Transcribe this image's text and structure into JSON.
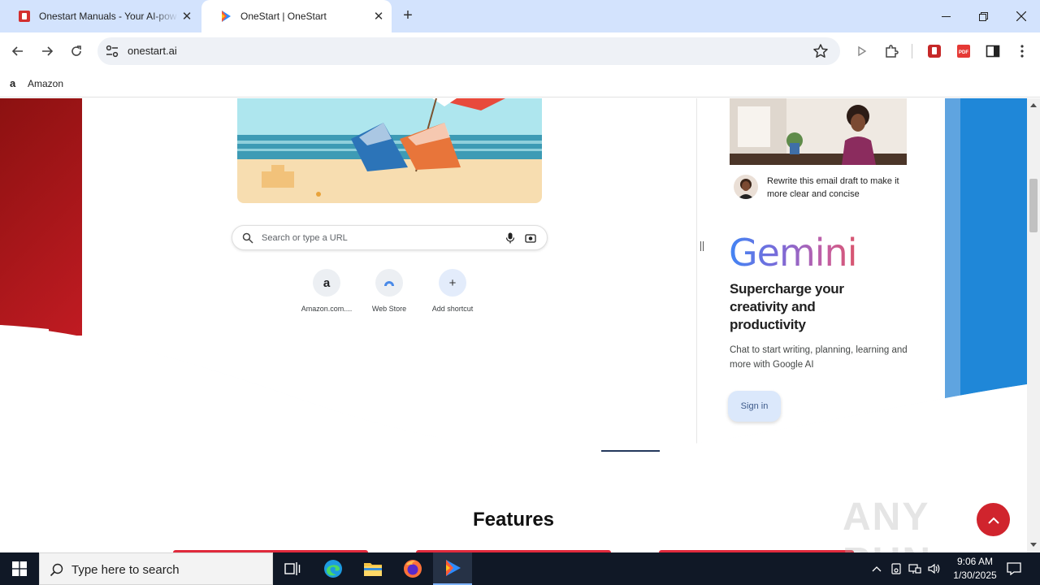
{
  "browser": {
    "tabs": [
      {
        "title": "Onestart Manuals - Your AI-pow",
        "active": false,
        "icon": "onestart-manuals-icon"
      },
      {
        "title": "OneStart | OneStart",
        "active": true,
        "icon": "onestart-logo-icon"
      }
    ],
    "url": "onestart.ai",
    "bookmarks": [
      {
        "label": "Amazon",
        "icon": "amazon-icon"
      }
    ]
  },
  "ntp": {
    "search_placeholder": "Search or type a URL",
    "shortcuts": [
      {
        "label": "Amazon.com....",
        "icon": "amazon-icon"
      },
      {
        "label": "Web Store",
        "icon": "web-store-icon"
      },
      {
        "label": "Add shortcut",
        "icon": "plus-icon"
      }
    ]
  },
  "gemini": {
    "prompt_text": "Rewrite this email draft to make it more clear and concise",
    "logo_text": "Gemini",
    "headline": "Supercharge your creativity and productivity",
    "subtext": "Chat to start writing, planning, learning and more with Google AI",
    "signin_label": "Sign in"
  },
  "page": {
    "section_title": "Features",
    "watermark": "ANY RUN"
  },
  "taskbar": {
    "search_placeholder": "Type here to search",
    "time": "9:06 AM",
    "date": "1/30/2025"
  },
  "colors": {
    "accent_red": "#d0242d",
    "tab_strip": "#d3e3fd",
    "taskbar": "#101826",
    "side_blue": "#1f87d8"
  }
}
